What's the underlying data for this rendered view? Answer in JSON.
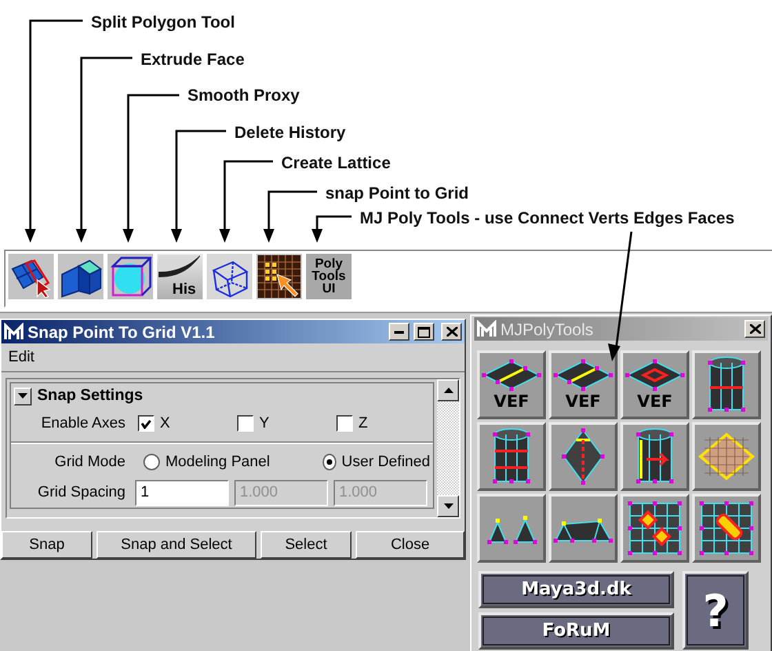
{
  "callouts": [
    {
      "label": "Split Polygon Tool"
    },
    {
      "label": "Extrude Face"
    },
    {
      "label": "Smooth Proxy"
    },
    {
      "label": "Delete History"
    },
    {
      "label": "Create Lattice"
    },
    {
      "label": "snap Point to Grid"
    },
    {
      "label": "MJ Poly Tools - use Connect Verts Edges Faces"
    }
  ],
  "shelf": [
    {
      "kind": "split"
    },
    {
      "kind": "extrude"
    },
    {
      "kind": "smooth"
    },
    {
      "kind": "history",
      "text": "His"
    },
    {
      "kind": "lattice"
    },
    {
      "kind": "snap"
    },
    {
      "kind": "text",
      "text": "Poly Tools UI"
    }
  ],
  "snap_window": {
    "title": "Snap Point To Grid V1.1",
    "menu": [
      "Edit"
    ],
    "frame": {
      "title": "Snap Settings",
      "expanded": true
    },
    "axes": {
      "label": "Enable Axes",
      "items": [
        {
          "label": "X",
          "checked": true
        },
        {
          "label": "Y",
          "checked": false
        },
        {
          "label": "Z",
          "checked": false
        }
      ]
    },
    "grid_mode": {
      "label": "Grid Mode",
      "options": [
        {
          "label": "Modeling Panel",
          "selected": false
        },
        {
          "label": "User Defined",
          "selected": true
        }
      ]
    },
    "grid_spacing": {
      "label": "Grid Spacing",
      "fields": [
        {
          "value": "1",
          "disabled": false
        },
        {
          "value": "1.000",
          "disabled": true
        },
        {
          "value": "1.000",
          "disabled": true
        }
      ]
    },
    "buttons": [
      "Snap",
      "Snap and Select",
      "Select",
      "Close"
    ]
  },
  "mj_window": {
    "title": "MJPolyTools",
    "tools": [
      {
        "kind": "plane-edge",
        "text": "VEF"
      },
      {
        "kind": "plane-edge",
        "text": "VEF"
      },
      {
        "kind": "plane-face",
        "text": "VEF"
      },
      {
        "kind": "cylinder-ring"
      },
      {
        "kind": "cylinder-rings"
      },
      {
        "kind": "diamond-split"
      },
      {
        "kind": "cylinder-arrow"
      },
      {
        "kind": "grid-diamond"
      },
      {
        "kind": "cones"
      },
      {
        "kind": "bridge"
      },
      {
        "kind": "grid-faces"
      },
      {
        "kind": "grid-slot"
      }
    ],
    "links": [
      "Maya3d.dk",
      "FoRuM"
    ],
    "help": "?"
  }
}
